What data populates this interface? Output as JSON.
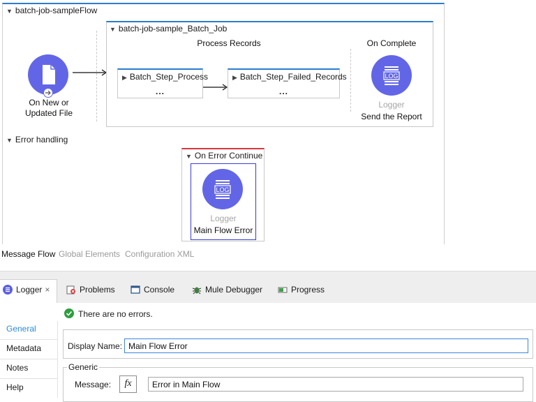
{
  "canvas": {
    "flow_name": "batch-job-sampleFlow",
    "trigger_label_line1": "On New or",
    "trigger_label_line2": "Updated File",
    "batch_job_name": "batch-job-sample_Batch_Job",
    "process_records_label": "Process Records",
    "on_complete_label": "On Complete",
    "steps": [
      {
        "name": "Batch_Step_Process",
        "dots": "..."
      },
      {
        "name": "Batch_Step_Failed_Records",
        "dots": "..."
      }
    ],
    "complete_logger": {
      "badge": "LOG",
      "type": "Logger",
      "name": "Send the Report"
    },
    "error_handling_label": "Error handling",
    "on_error_continue_label": "On Error Continue",
    "error_logger": {
      "badge": "LOG",
      "type": "Logger",
      "name": "Main Flow Error"
    }
  },
  "editor_tabs": [
    "Message Flow",
    "Global Elements",
    "Configuration XML"
  ],
  "properties": {
    "tabs": [
      {
        "label": "Logger",
        "icon": "logger-icon"
      },
      {
        "label": "Problems",
        "icon": "problems-icon"
      },
      {
        "label": "Console",
        "icon": "console-icon"
      },
      {
        "label": "Mule Debugger",
        "icon": "debugger-icon"
      },
      {
        "label": "Progress",
        "icon": "progress-icon"
      }
    ],
    "close_glyph": "×",
    "status_text": "There are no errors.",
    "side_items": [
      "General",
      "Metadata",
      "Notes",
      "Help"
    ],
    "display_name_label": "Display Name:",
    "display_name_value": "Main Flow Error",
    "generic_group_label": "Generic",
    "message_label": "Message:",
    "fx_label": "fx",
    "message_value": "Error in Main Flow"
  },
  "colors": {
    "accent_blue": "#2b7bd0",
    "logger_circle": "#6266e6",
    "error_red": "#d9363e",
    "selected_side": "#2b8bd8",
    "ok_green": "#2e9e3e"
  }
}
